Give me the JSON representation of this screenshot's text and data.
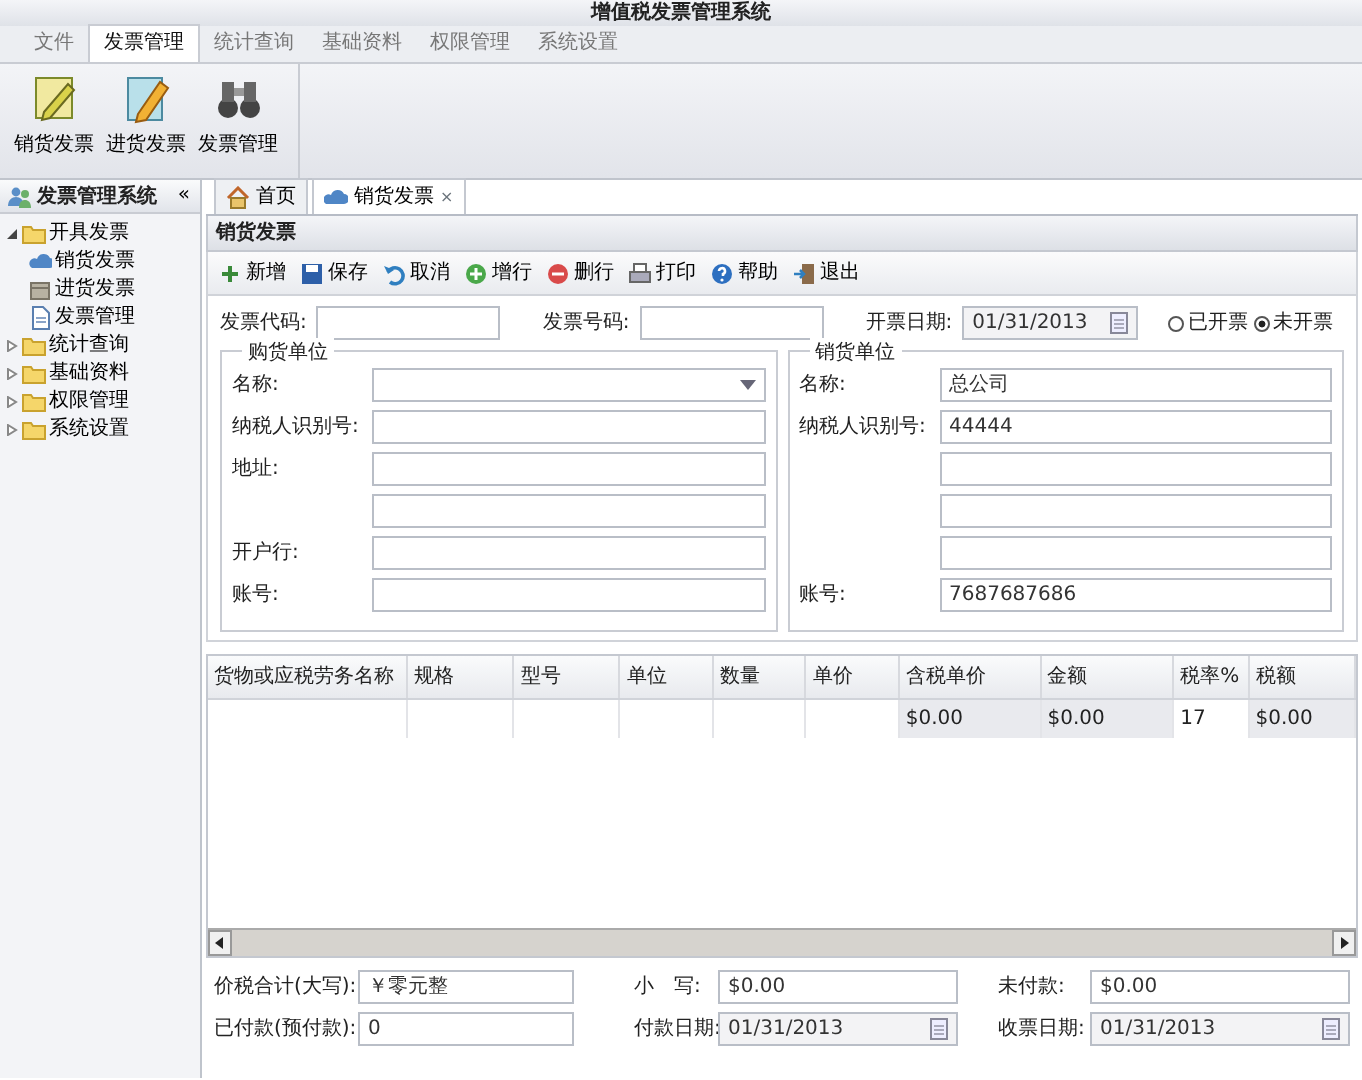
{
  "window": {
    "title": "增值税发票管理系统"
  },
  "menu_tabs": [
    {
      "label": "文件",
      "selected": false
    },
    {
      "label": "发票管理",
      "selected": true
    },
    {
      "label": "统计查询",
      "selected": false
    },
    {
      "label": "基础资料",
      "selected": false
    },
    {
      "label": "权限管理",
      "selected": false
    },
    {
      "label": "系统设置",
      "selected": false
    }
  ],
  "ribbon": [
    {
      "label": "销货发票"
    },
    {
      "label": "进货发票"
    },
    {
      "label": "发票管理"
    }
  ],
  "sidebar": {
    "title": "发票管理系统",
    "collapse": "«",
    "items": [
      {
        "label": "开具发票",
        "expanded": true,
        "children": [
          {
            "label": "销货发票"
          },
          {
            "label": "进货发票"
          },
          {
            "label": "发票管理"
          }
        ]
      },
      {
        "label": "统计查询",
        "expanded": false
      },
      {
        "label": "基础资料",
        "expanded": false
      },
      {
        "label": "权限管理",
        "expanded": false
      },
      {
        "label": "系统设置",
        "expanded": false
      }
    ]
  },
  "doc_tabs": [
    {
      "label": "首页",
      "selected": false
    },
    {
      "label": "销货发票",
      "selected": true,
      "close": "×"
    }
  ],
  "panel": {
    "title": "销货发票"
  },
  "toolbar": [
    {
      "label": "新增"
    },
    {
      "label": "保存"
    },
    {
      "label": "取消"
    },
    {
      "label": "增行"
    },
    {
      "label": "删行"
    },
    {
      "label": "打印"
    },
    {
      "label": "帮助"
    },
    {
      "label": "退出"
    }
  ],
  "header_fields": [
    {
      "label": "发票代码:",
      "kind": "text"
    },
    {
      "label": "发票号码:",
      "kind": "text"
    },
    {
      "label": "开票日期:",
      "kind": "date",
      "value": "01/31/2013"
    }
  ],
  "status_radios": [
    {
      "label": "已开票",
      "selected": false
    },
    {
      "label": "未开票",
      "selected": true
    }
  ],
  "buyer": {
    "title": "购货单位",
    "fields": [
      {
        "label": "名称:",
        "kind": "select"
      },
      {
        "label": "纳税人识别号:",
        "kind": "text"
      },
      {
        "label": "地址:",
        "kind": "text"
      },
      {
        "kind": "text"
      },
      {
        "label": "开户行:",
        "kind": "text"
      },
      {
        "label": "账号:",
        "kind": "text"
      }
    ]
  },
  "seller": {
    "title": "销货单位",
    "fields": [
      {
        "label": "名称:",
        "kind": "text",
        "value": "总公司"
      },
      {
        "label": "纳税人识别号:",
        "kind": "text",
        "value": "44444"
      },
      {
        "kind": "text"
      },
      {
        "kind": "text"
      },
      {
        "kind": "text"
      },
      {
        "label": "账号:",
        "kind": "text",
        "value": "7687687686"
      }
    ]
  },
  "table": {
    "columns": [
      "货物或应税劳务名称",
      "规格",
      "型号",
      "单位",
      "数量",
      "单价",
      "含税单价",
      "金额",
      "税率%",
      "税额"
    ],
    "rows": [
      [
        "",
        "",
        "",
        "",
        "",
        "",
        "$0.00",
        "$0.00",
        "17",
        "$0.00"
      ]
    ]
  },
  "totals": [
    {
      "label": "价税合计(大写):",
      "kind": "text",
      "value": "￥零元整"
    },
    {
      "label": "小　写:",
      "kind": "text",
      "value": "$0.00"
    },
    {
      "label": "未付款:",
      "kind": "text",
      "value": "$0.00"
    },
    {
      "label": "已付款(预付款):",
      "kind": "text",
      "value": "0"
    },
    {
      "label": "付款日期:",
      "kind": "date",
      "value": "01/31/2013"
    },
    {
      "label": "收票日期:",
      "kind": "date",
      "value": "01/31/2013"
    }
  ]
}
